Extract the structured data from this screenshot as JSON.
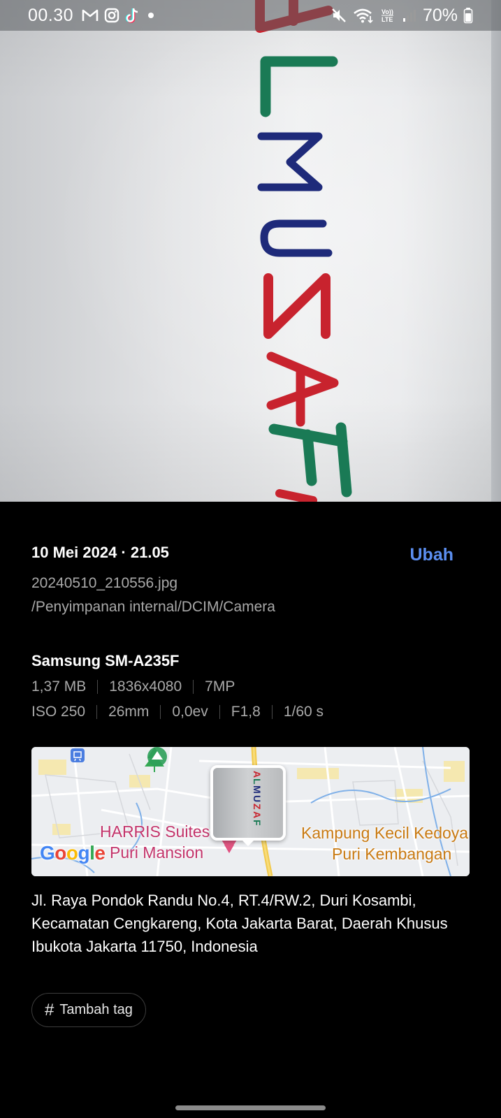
{
  "status_bar": {
    "time": "00.30",
    "battery": "70%",
    "left_icons": [
      "gmail-icon",
      "instagram-icon",
      "tiktok-icon",
      "dot-icon"
    ],
    "right_icons": [
      "mute-icon",
      "wifi-icon",
      "volte-icon",
      "signal-icon",
      "battery-icon"
    ],
    "volte_label": "Vo))\nLTE"
  },
  "photo": {
    "handwriting": [
      "A",
      "L",
      "M",
      "U",
      "Z",
      "A",
      "F"
    ],
    "handwriting_colors": [
      "#c8232e",
      "#1a7a55",
      "#1e2a7a",
      "#1e2a7a",
      "#c8232e",
      "#c8232e",
      "#1a7a55"
    ]
  },
  "details": {
    "date": "10 Mei 2024 · 21.05",
    "edit_label": "Ubah",
    "filename": "20240510_210556.jpg",
    "path": "/Penyimpanan internal/DCIM/Camera",
    "device": "Samsung SM-A235F",
    "file_meta": [
      "1,37 MB",
      "1836x4080",
      "7MP"
    ],
    "camera_meta": [
      "ISO 250",
      "26mm",
      "0,0ev",
      "F1,8",
      "1/60 s"
    ]
  },
  "map": {
    "labels": {
      "harris": "HARRIS Suites",
      "puri_mansion": "Puri Mansion",
      "kampung": "Kampung Kecil Kedoya",
      "puri_kembangan": "Puri Kembangan"
    },
    "logo": [
      "G",
      "o",
      "o",
      "g",
      "l",
      "e"
    ],
    "logo_colors": [
      "#4285f4",
      "#ea4335",
      "#fbbc05",
      "#4285f4",
      "#34a853",
      "#ea4335"
    ]
  },
  "address": "Jl. Raya Pondok Randu No.4, RT.4/RW.2, Duri Kosambi, Kecamatan Cengkareng, Kota Jakarta Barat, Daerah Khusus Ibukota Jakarta 11750, Indonesia",
  "tag_button": {
    "label": "Tambah tag"
  },
  "colors": {
    "accent": "#5b8ef0",
    "background": "#000000",
    "secondary_text": "#a9a9a9"
  }
}
